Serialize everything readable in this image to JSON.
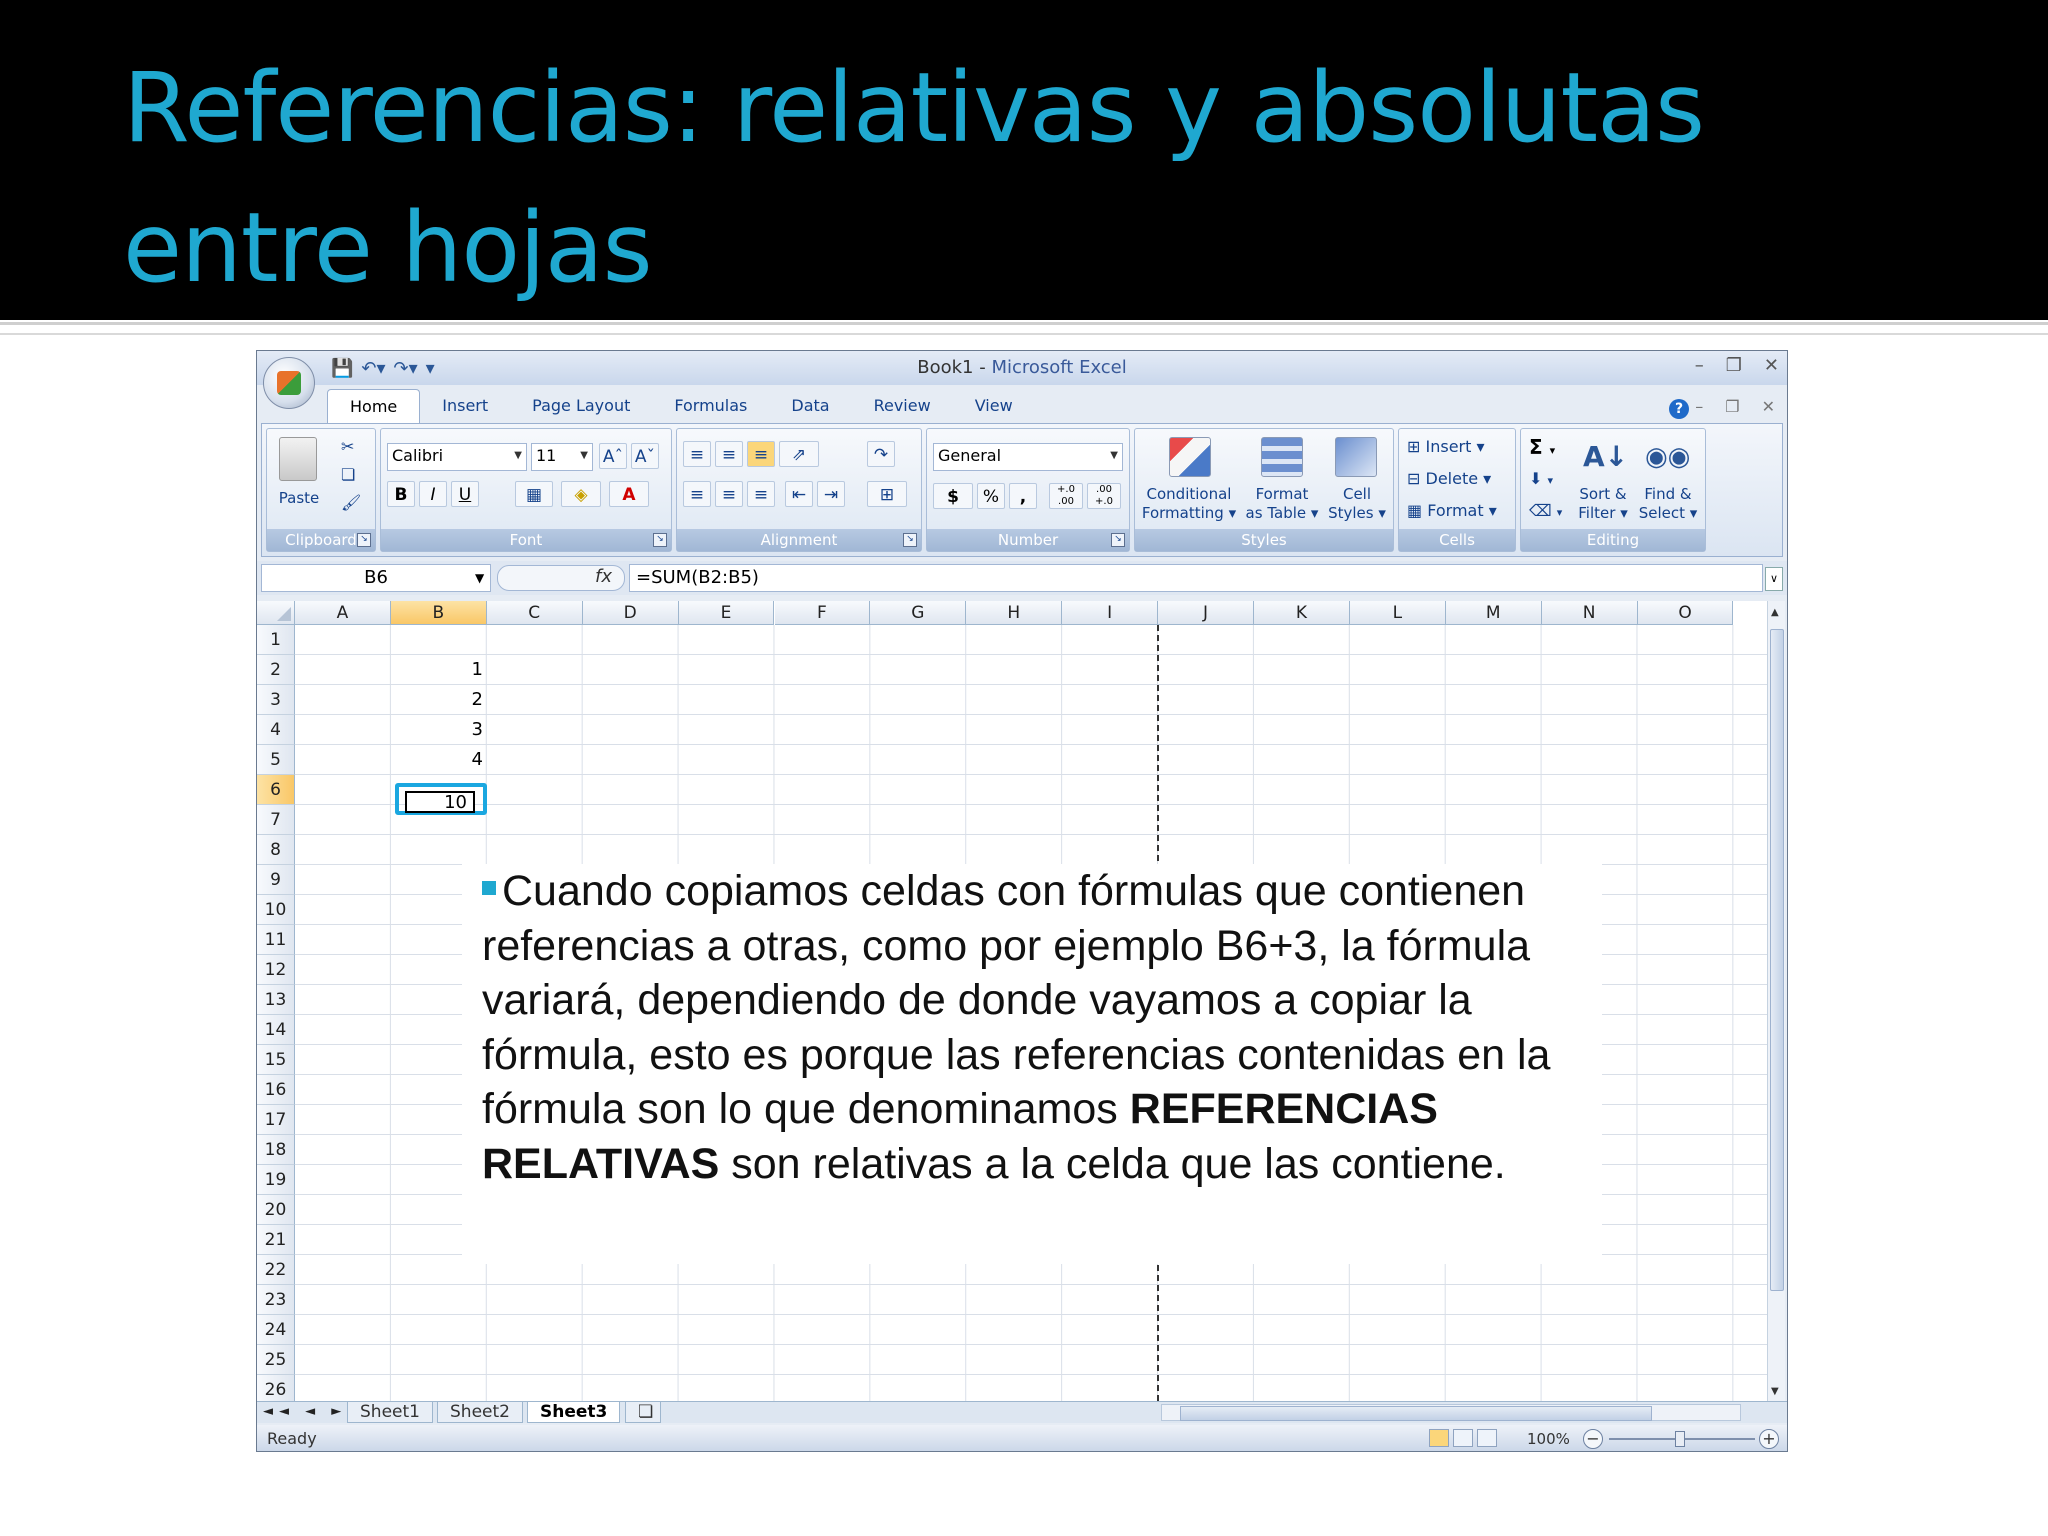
{
  "slide": {
    "title_line1": "Referencias: relativas y absolutas",
    "title_line2": "entre hojas"
  },
  "window": {
    "doc_name": "Book1",
    "separator": " - ",
    "app_name": "Microsoft Excel"
  },
  "ribbon": {
    "tabs": [
      "Home",
      "Insert",
      "Page Layout",
      "Formulas",
      "Data",
      "Review",
      "View"
    ],
    "active_tab": "Home",
    "clipboard": {
      "label": "Clipboard",
      "paste": "Paste"
    },
    "font": {
      "label": "Font",
      "name": "Calibri",
      "size": "11",
      "bold": "B",
      "italic": "I",
      "underline": "U"
    },
    "alignment": {
      "label": "Alignment"
    },
    "number": {
      "label": "Number",
      "format": "General",
      "currency": "$",
      "percent": "%",
      "comma": ",",
      "inc_decimal": "+.0 .00",
      "dec_decimal": ".00 +.0"
    },
    "styles": {
      "label": "Styles",
      "conditional_1": "Conditional",
      "conditional_2": "Formatting",
      "table_1": "Format",
      "table_2": "as Table",
      "cell_1": "Cell",
      "cell_2": "Styles"
    },
    "cells": {
      "label": "Cells",
      "insert": "Insert",
      "delete": "Delete",
      "format": "Format"
    },
    "editing": {
      "label": "Editing",
      "sigma": "Σ",
      "sort_1": "Sort &",
      "sort_2": "Filter",
      "find_1": "Find &",
      "find_2": "Select"
    }
  },
  "formula_bar": {
    "name_box": "B6",
    "fx": "fx",
    "formula": "=SUM(B2:B5)"
  },
  "grid": {
    "columns": [
      "A",
      "B",
      "C",
      "D",
      "E",
      "F",
      "G",
      "H",
      "I",
      "J",
      "K",
      "L",
      "M",
      "N",
      "O"
    ],
    "selected_column": "B",
    "rows": [
      "1",
      "2",
      "3",
      "4",
      "5",
      "6",
      "7",
      "8",
      "9",
      "10",
      "11",
      "12",
      "13",
      "14",
      "15",
      "16",
      "17",
      "18",
      "19",
      "20",
      "21",
      "22",
      "23",
      "24",
      "25",
      "26"
    ],
    "selected_row": "6",
    "cells": {
      "B2": "1",
      "B3": "2",
      "B4": "3",
      "B5": "4",
      "B6": "10"
    },
    "active_cell": "B6"
  },
  "note": {
    "part1": "Cuando copiamos celdas con fórmulas que contienen referencias a otras, como por ejemplo B6+3, la fórmula variará, dependiendo de donde vayamos a copiar la fórmula, esto es porque las referencias contenidas en la fórmula son lo que denominamos ",
    "bold": "REFERENCIAS RELATIVAS",
    "part2": " son relativas a la celda que las contiene."
  },
  "sheets": {
    "tabs": [
      "Sheet1",
      "Sheet2",
      "Sheet3"
    ],
    "active": "Sheet3",
    "nav": "◄◄ ◄ ► ►►"
  },
  "status": {
    "text": "Ready",
    "zoom": "100%"
  },
  "colors": {
    "title": "#1fa8d0",
    "active_cell_border": "#1aa7e0",
    "selected_header": "#f9c767"
  }
}
